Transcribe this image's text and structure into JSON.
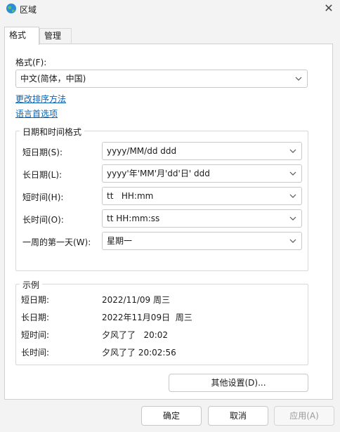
{
  "window": {
    "title": "区域",
    "icon": "globe-icon",
    "close_icon": "close-icon"
  },
  "tabs": [
    {
      "label": "格式",
      "active": true
    },
    {
      "label": "管理",
      "active": false
    }
  ],
  "format": {
    "label": "格式(F):",
    "selected": "中文(简体，中国)"
  },
  "links": {
    "sort": "更改排序方法",
    "language": "语言首选项"
  },
  "datetime_group": {
    "title": "日期和时间格式",
    "rows": [
      {
        "label": "短日期(S):",
        "value": "yyyy/MM/dd ddd"
      },
      {
        "label": "长日期(L):",
        "value": "yyyy'年'MM'月'dd'日'  ddd"
      },
      {
        "label": "短时间(H):",
        "value": "tt   HH:mm"
      },
      {
        "label": "长时间(O):",
        "value": "tt HH:mm:ss"
      },
      {
        "label": "一周的第一天(W):",
        "value": "星期一"
      }
    ]
  },
  "example_group": {
    "title": "示例",
    "rows": [
      {
        "label": "短日期:",
        "value": "2022/11/09 周三"
      },
      {
        "label": "长日期:",
        "value": "2022年11月09日  周三"
      },
      {
        "label": "短时间:",
        "value": "夕风了了   20:02"
      },
      {
        "label": "长时间:",
        "value": "夕风了了 20:02:56"
      }
    ]
  },
  "buttons": {
    "other": "其他设置(D)...",
    "ok": "确定",
    "cancel": "取消",
    "apply": "应用(A)"
  }
}
